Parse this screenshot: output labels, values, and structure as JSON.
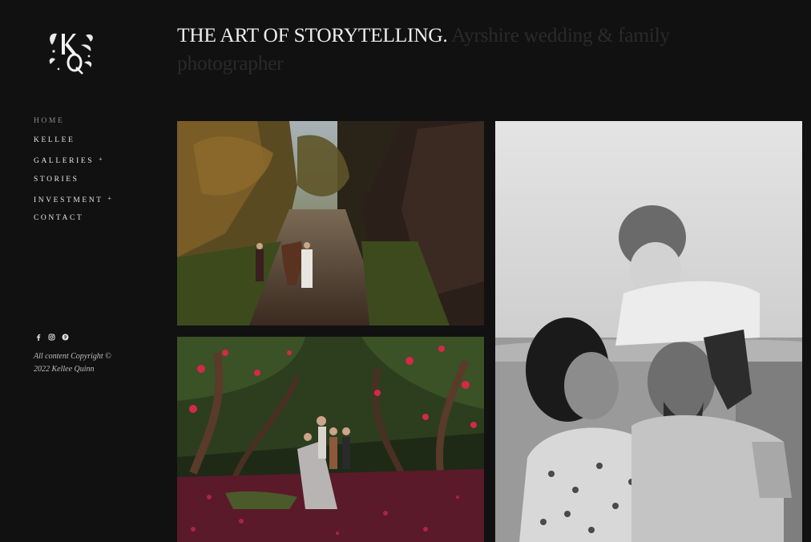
{
  "logo": {
    "icon": "monogram-logo",
    "letters_top": "KQ"
  },
  "nav": {
    "home": "HOME",
    "kellee": "KELLEE",
    "galleries": "GALLERIES",
    "stories": "STORIES",
    "investment": "INVESTMENT",
    "contact": "CONTACT",
    "caret": "+"
  },
  "social": {
    "icons": [
      "facebook-icon",
      "instagram-icon",
      "pinterest-icon"
    ],
    "facebook_glyph": "f"
  },
  "footer": {
    "copyright_line1": "All content Copyright ©",
    "copyright_line2": "2022 Kellee Quinn"
  },
  "hero": {
    "headline_lead": "THE ART OF STORYTELLING.",
    "headline_rest": " Ayrshire wedding & family photographer"
  },
  "colors": {
    "background": "#111111",
    "text": "#e6e6e6",
    "nav_active": "#8c8c8c"
  }
}
